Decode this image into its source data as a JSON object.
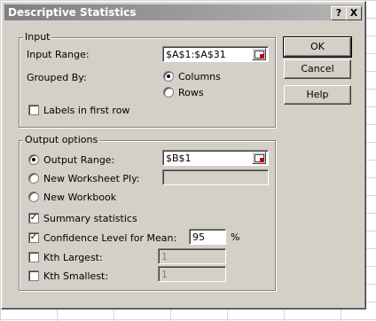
{
  "dialog": {
    "title": "Descriptive Statistics",
    "help_glyph": "?",
    "close_glyph": "X"
  },
  "input": {
    "group_label": "Input",
    "input_range_label": "Input Range:",
    "input_range_value": "$A$1:$A$31",
    "grouped_by_label": "Grouped By:",
    "columns_label": "Columns",
    "rows_label": "Rows",
    "labels_first_row_label": "Labels in first row"
  },
  "output": {
    "group_label": "Output options",
    "output_range_label": "Output Range:",
    "output_range_value": "$B$1",
    "new_worksheet_label": "New Worksheet Ply:",
    "new_workbook_label": "New Workbook",
    "summary_label": "Summary statistics",
    "confidence_label": "Confidence Level for Mean:",
    "confidence_value": "95",
    "percent": "%",
    "kth_largest_label": "Kth Largest:",
    "kth_largest_value": "1",
    "kth_smallest_label": "Kth Smallest:",
    "kth_smallest_value": "1"
  },
  "buttons": {
    "ok": "OK",
    "cancel": "Cancel",
    "help": "Help"
  },
  "check_glyph": "✓"
}
